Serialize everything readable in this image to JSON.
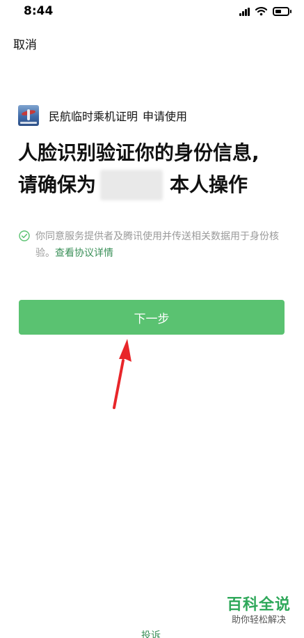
{
  "status_bar": {
    "time": "8:44",
    "battery_level": 0.5
  },
  "nav": {
    "cancel_label": "取消"
  },
  "app": {
    "name": "民航临时乘机证明",
    "request_text": "申请使用",
    "logo_icon": "airplane-logo-icon"
  },
  "headline": {
    "line1": "人脸识别验证你的身份信息,",
    "line2_prefix": "请确保为",
    "line2_suffix": "本人操作"
  },
  "consent": {
    "text": "你同意服务提供者及腾讯使用并传送相关数据用于身份核验。",
    "link_text": "查看协议详情",
    "icon": "check-circle-icon"
  },
  "actions": {
    "next_label": "下一步",
    "complaint_label": "投诉"
  },
  "watermark": {
    "title": "百科全说",
    "subtitle": "助你轻松解决"
  },
  "colors": {
    "accent_green": "#5ac271",
    "link_green": "#3a8f58",
    "annotation_red": "#e8262a"
  }
}
